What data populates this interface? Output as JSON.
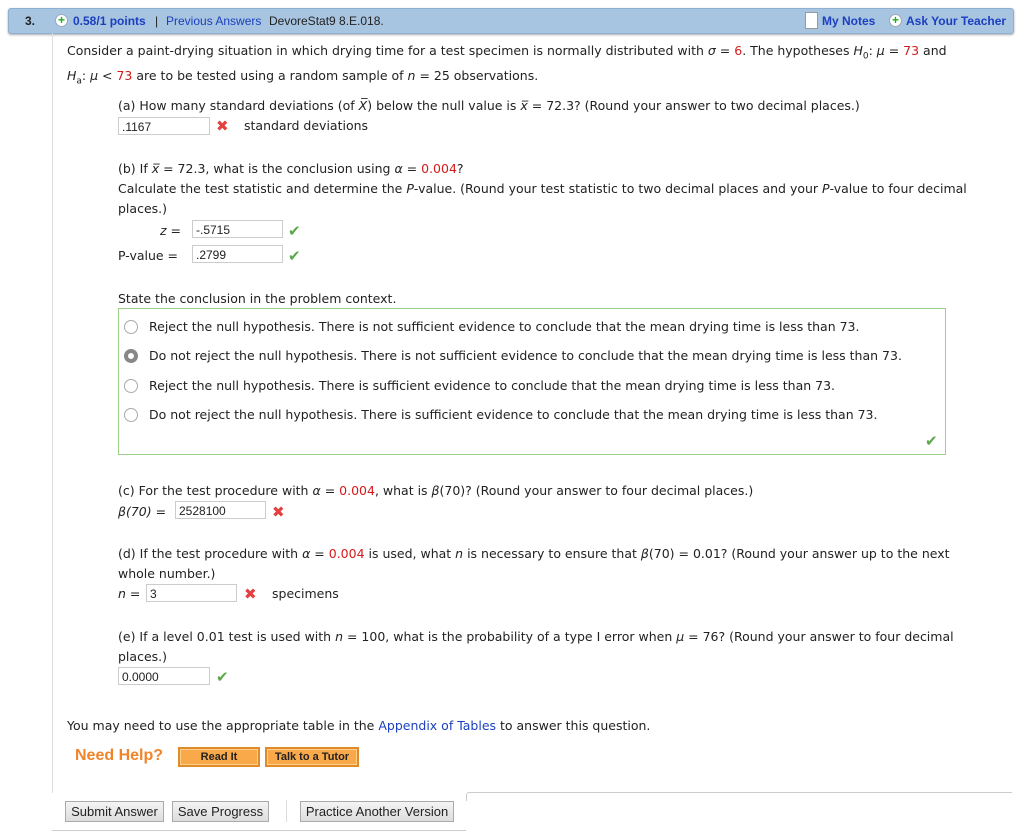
{
  "header": {
    "number": "3.",
    "points": "0.58/1 points",
    "separator": "|",
    "previous": "Previous Answers",
    "source": "DevoreStat9 8.E.018.",
    "my_notes": "My Notes",
    "ask_teacher": "Ask Your Teacher"
  },
  "intro": {
    "line1": [
      {
        "t": "Consider a paint-drying situation in which drying time for a test specimen is normally distributed with "
      },
      {
        "t": "σ",
        "s": "i"
      },
      {
        "t": " = "
      },
      {
        "t": "6",
        "s": "red"
      },
      {
        "t": ". The hypotheses "
      },
      {
        "t": "H",
        "s": "i"
      },
      {
        "t": "0",
        "s": "sub"
      },
      {
        "t": ": "
      },
      {
        "t": "μ",
        "s": "i"
      },
      {
        "t": " = "
      },
      {
        "t": "73",
        "s": "red"
      },
      {
        "t": " and"
      }
    ],
    "line2": [
      {
        "t": "H",
        "s": "i"
      },
      {
        "t": "a",
        "s": "sub"
      },
      {
        "t": ": "
      },
      {
        "t": "μ",
        "s": "i"
      },
      {
        "t": " < "
      },
      {
        "t": "73",
        "s": "red"
      },
      {
        "t": " are to be tested using a random sample of "
      },
      {
        "t": "n",
        "s": "i"
      },
      {
        "t": " = 25 observations."
      }
    ]
  },
  "a": {
    "q": [
      {
        "t": "(a) How many standard deviations (of "
      },
      {
        "t": "X̅",
        "s": "i"
      },
      {
        "t": ") below the null value is "
      },
      {
        "t": "x̅",
        "s": "i"
      },
      {
        "t": " = 72.3? (Round your answer to two decimal places.)"
      }
    ],
    "value": ".1167",
    "unit": "standard deviations",
    "status": "incorrect"
  },
  "b": {
    "q": [
      {
        "t": "(b) If "
      },
      {
        "t": "x̅",
        "s": "i"
      },
      {
        "t": " = 72.3, what is the conclusion using "
      },
      {
        "t": "α",
        "s": "i"
      },
      {
        "t": " = "
      },
      {
        "t": "0.004",
        "s": "red"
      },
      {
        "t": "?"
      }
    ],
    "q2": [
      {
        "t": "Calculate the test statistic and determine the "
      },
      {
        "t": "P",
        "s": "i"
      },
      {
        "t": "-value. (Round your test statistic to two decimal places and your "
      },
      {
        "t": "P",
        "s": "i"
      },
      {
        "t": "-value to four decimal"
      }
    ],
    "q3": "places.)",
    "z_label": "z  =",
    "z_value": "-.5715",
    "p_label": "P-value  =",
    "p_value": ".2799",
    "z_status": "correct",
    "p_status": "correct",
    "conclusion_prompt": "State the conclusion in the problem context.",
    "options": [
      "Reject the null hypothesis. There is not sufficient evidence to conclude that the mean drying time is less than 73.",
      "Do not reject the null hypothesis. There is not sufficient evidence to conclude that the mean drying time is less than 73.",
      "Reject the null hypothesis. There is sufficient evidence to conclude that the mean drying time is less than 73.",
      "Do not reject the null hypothesis. There is sufficient evidence to conclude that the mean drying time is less than 73."
    ],
    "selected": 1
  },
  "c": {
    "q": [
      {
        "t": "(c) For the test procedure with "
      },
      {
        "t": "α",
        "s": "i"
      },
      {
        "t": " = "
      },
      {
        "t": "0.004",
        "s": "red"
      },
      {
        "t": ", what is "
      },
      {
        "t": "β",
        "s": "i"
      },
      {
        "t": "(70)? (Round your answer to four decimal places.)"
      }
    ],
    "label": "β(70)  =",
    "value": "2528100",
    "status": "incorrect"
  },
  "d": {
    "q": [
      {
        "t": "(d) If the test procedure with "
      },
      {
        "t": "α",
        "s": "i"
      },
      {
        "t": " = "
      },
      {
        "t": "0.004",
        "s": "red"
      },
      {
        "t": " is used, what "
      },
      {
        "t": "n",
        "s": "i"
      },
      {
        "t": " is necessary to ensure that "
      },
      {
        "t": "β",
        "s": "i"
      },
      {
        "t": "(70) = 0.01? (Round your answer up to the next"
      }
    ],
    "q2": "whole number.)",
    "label": "n  =",
    "value": "3",
    "unit": "specimens",
    "status": "incorrect"
  },
  "e": {
    "q": [
      {
        "t": "(e) If a level 0.01 test is used with "
      },
      {
        "t": "n",
        "s": "i"
      },
      {
        "t": " = 100, what is the probability of a type I error when "
      },
      {
        "t": "μ",
        "s": "i"
      },
      {
        "t": " = 76? (Round your answer to four decimal"
      }
    ],
    "q2": "places.)",
    "value": "0.0000",
    "status": "correct"
  },
  "footer": {
    "appendix_pre": "You may need to use the appropriate table in the ",
    "appendix_link": "Appendix of Tables",
    "appendix_post": " to answer this question.",
    "need_help": "Need Help?",
    "read_it": "Read It",
    "tutor": "Talk to a Tutor",
    "submit": "Submit Answer",
    "save": "Save Progress",
    "practice": "Practice Another Version"
  },
  "icons": {
    "incorrect": "✖",
    "correct": "✔",
    "plus": "+"
  },
  "colors": {
    "accent_red": "#d41b1b",
    "header_bg": "#a7c4e0",
    "link": "#1b3fbf",
    "help_orange": "#f0842a"
  }
}
